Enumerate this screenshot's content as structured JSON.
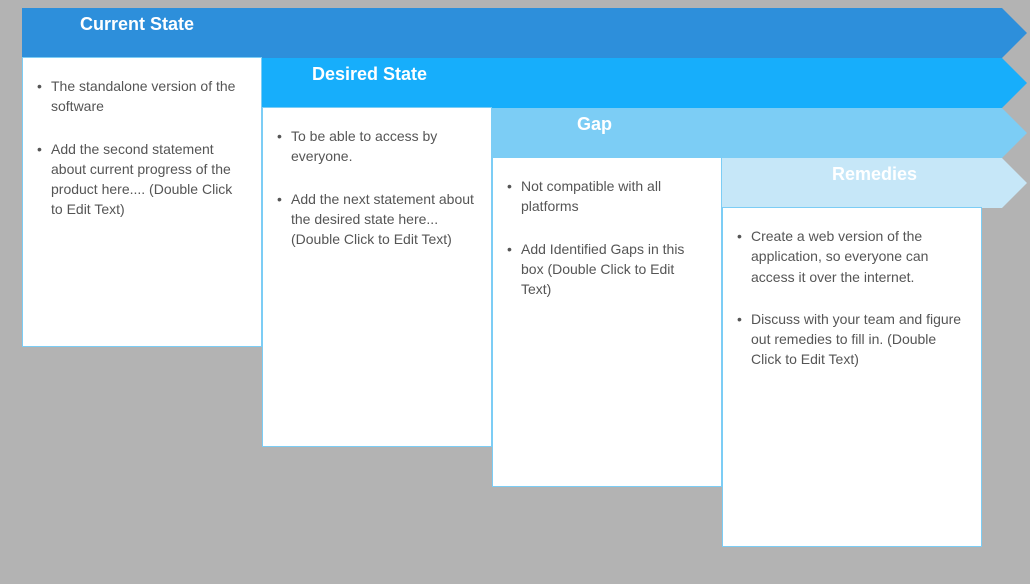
{
  "sections": [
    {
      "title": "Current State",
      "items": [
        "The standalone version of the software",
        "Add the second statement about current progress of the product here....\n(Double Click to Edit Text)"
      ]
    },
    {
      "title": "Desired State",
      "items": [
        "To be able to access by everyone.",
        "Add the next statement about the desired state here...       (Double Click to Edit Text)"
      ]
    },
    {
      "title": "Gap",
      "items": [
        "Not compatible with all platforms",
        "Add Identified Gaps in this box (Double Click to Edit Text)"
      ]
    },
    {
      "title": "Remedies",
      "items": [
        "Create a web version of the application, so everyone  can access it over the internet.",
        "Discuss with your team and figure out  remedies to fill in. (Double Click to Edit Text)"
      ]
    }
  ]
}
